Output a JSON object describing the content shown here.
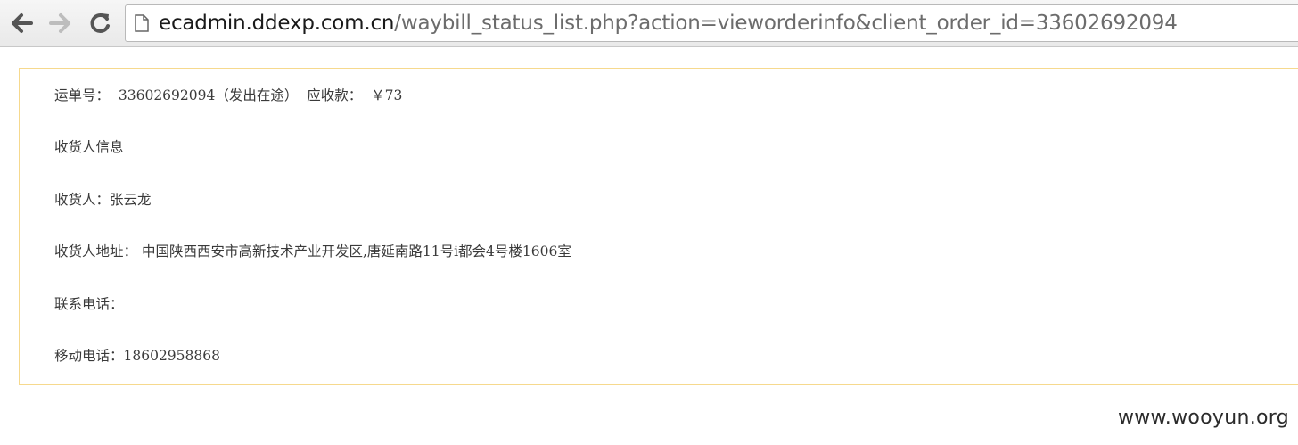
{
  "browser": {
    "back_icon": "back-arrow-icon",
    "forward_icon": "forward-arrow-icon",
    "reload_icon": "reload-icon",
    "page_icon": "page-icon",
    "url_host": "ecadmin.ddexp.com.cn",
    "url_path": "/waybill_status_list.php?action=vieworderinfo&client_order_id=33602692094"
  },
  "waybill": {
    "label": "运单号：",
    "number_status": "33602692094（发出在途）",
    "receivable_label": "应收款：",
    "receivable_value": "￥73"
  },
  "consignee": {
    "section_title": "收货人信息",
    "name_line": "收货人：张云龙",
    "address_label": "收货人地址：",
    "address_value": "中国陕西西安市高新技术产业开发区,唐延南路11号i都会4号楼1606室",
    "phone_line": "联系电话：",
    "mobile_line": "移动电话：18602958868"
  },
  "watermark": "www.wooyun.org",
  "colors": {
    "box_border": "#f6d98d",
    "text": "#3a3a3a"
  }
}
